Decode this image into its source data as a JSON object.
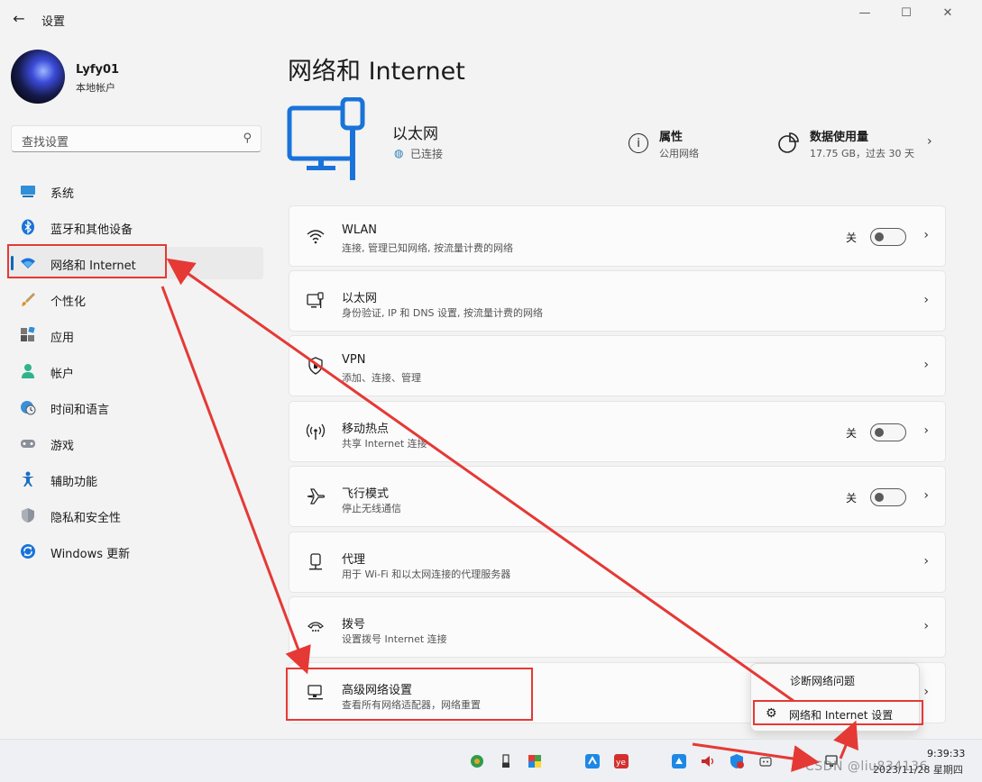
{
  "window": {
    "title": "设置",
    "back_icon": "arrow-left-icon",
    "controls": {
      "minimize": "—",
      "maximize": "☐",
      "close": "✕"
    }
  },
  "user": {
    "name": "Lyfy01",
    "account_type": "本地帐户"
  },
  "search": {
    "placeholder": "查找设置",
    "icon": "search-icon"
  },
  "sidebar": {
    "items": [
      {
        "label": "系统",
        "icon": "monitor-icon",
        "active": false
      },
      {
        "label": "蓝牙和其他设备",
        "icon": "bluetooth-icon",
        "active": false
      },
      {
        "label": "网络和 Internet",
        "icon": "wifi-icon",
        "active": true
      },
      {
        "label": "个性化",
        "icon": "brush-icon",
        "active": false
      },
      {
        "label": "应用",
        "icon": "apps-icon",
        "active": false
      },
      {
        "label": "帐户",
        "icon": "person-icon",
        "active": false
      },
      {
        "label": "时间和语言",
        "icon": "globe-clock-icon",
        "active": false
      },
      {
        "label": "游戏",
        "icon": "gamepad-icon",
        "active": false
      },
      {
        "label": "辅助功能",
        "icon": "accessibility-icon",
        "active": false
      },
      {
        "label": "隐私和安全性",
        "icon": "shield-icon",
        "active": false
      },
      {
        "label": "Windows 更新",
        "icon": "update-icon",
        "active": false
      }
    ]
  },
  "main": {
    "page_title": "网络和 Internet",
    "ethernet": {
      "title": "以太网",
      "status": "已连接"
    },
    "properties": {
      "title": "属性",
      "value": "公用网络"
    },
    "data_usage": {
      "title": "数据使用量",
      "value": "17.75 GB，过去 30 天"
    },
    "cards": [
      {
        "title": "WLAN",
        "subtitle": "连接, 管理已知网络, 按流量计费的网络",
        "icon": "wifi-icon",
        "toggle": "关"
      },
      {
        "title": "以太网",
        "subtitle": "身份验证, IP 和 DNS 设置, 按流量计费的网络",
        "icon": "ethernet-icon"
      },
      {
        "title": "VPN",
        "subtitle": "添加、连接、管理",
        "icon": "vpn-shield-icon"
      },
      {
        "title": "移动热点",
        "subtitle": "共享 Internet 连接",
        "icon": "hotspot-icon",
        "toggle": "关"
      },
      {
        "title": "飞行模式",
        "subtitle": "停止无线通信",
        "icon": "airplane-icon",
        "toggle": "关"
      },
      {
        "title": "代理",
        "subtitle": "用于 Wi-Fi 和以太网连接的代理服务器",
        "icon": "proxy-icon"
      },
      {
        "title": "拨号",
        "subtitle": "设置拨号 Internet 连接",
        "icon": "dialup-icon"
      },
      {
        "title": "高级网络设置",
        "subtitle": "查看所有网络适配器，网络重置",
        "icon": "network-adapter-icon"
      }
    ]
  },
  "context_menu": {
    "items": [
      "诊断网络问题",
      "网络和 Internet 设置"
    ]
  },
  "taskbar": {
    "time": "9:39:33",
    "date": "2023/11/28 星期四",
    "watermark": "CSDN @liu834136"
  },
  "colors": {
    "accent": "#0067c0",
    "annotation": "#e53935"
  }
}
